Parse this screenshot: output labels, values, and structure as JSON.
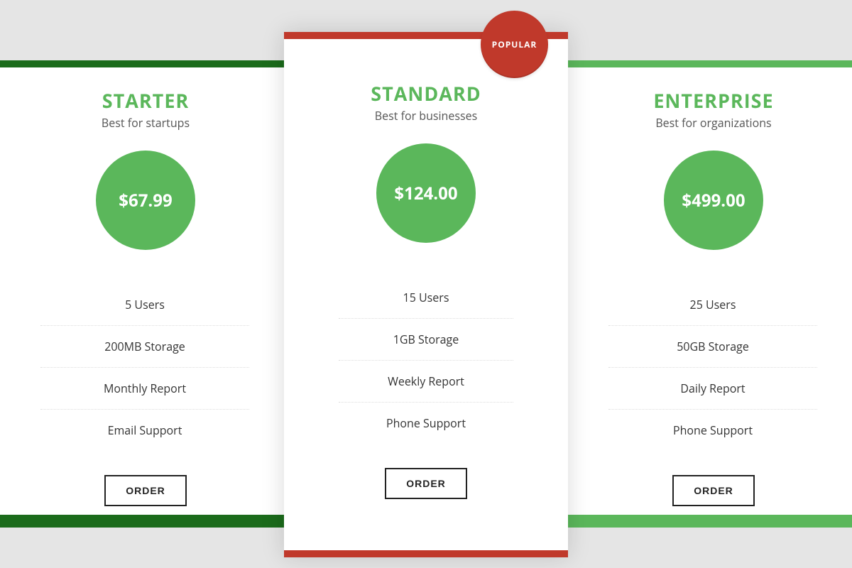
{
  "badge_label": "POPULAR",
  "order_label": "ORDER",
  "plans": {
    "starter": {
      "title": "STARTER",
      "subtitle": "Best for startups",
      "price": "$67.99",
      "features": [
        "5 Users",
        "200MB Storage",
        "Monthly Report",
        "Email Support"
      ]
    },
    "standard": {
      "title": "STANDARD",
      "subtitle": "Best for businesses",
      "price": "$124.00",
      "features": [
        "15 Users",
        "1GB Storage",
        "Weekly Report",
        "Phone Support"
      ]
    },
    "enterprise": {
      "title": "ENTERPRISE",
      "subtitle": "Best for organizations",
      "price": "$499.00",
      "features": [
        "25 Users",
        "50GB Storage",
        "Daily Report",
        "Phone Support"
      ]
    }
  },
  "colors": {
    "primary_green": "#5bb75b",
    "dark_green": "#1b6b1b",
    "accent_red": "#c0392b"
  }
}
